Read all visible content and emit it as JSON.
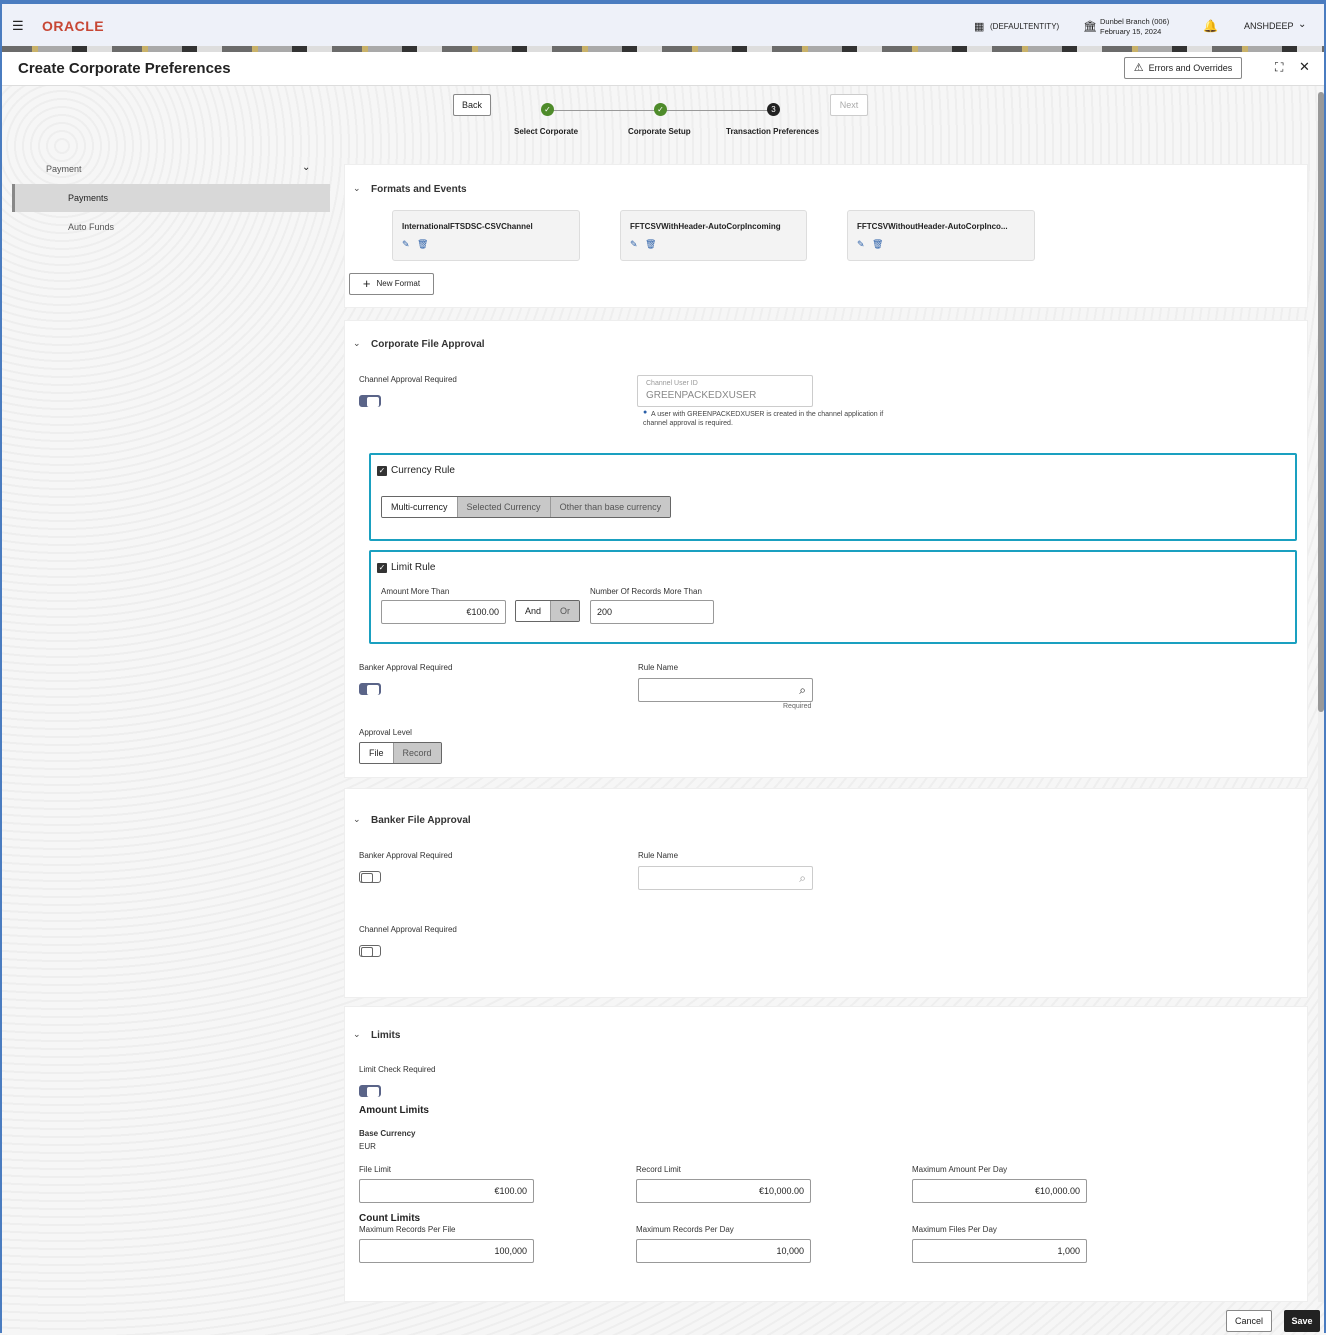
{
  "header": {
    "logo": "ORACLE",
    "entity": "(DEFAULTENTITY)",
    "branch": "Dunbel Branch (006)",
    "date": "February 15, 2024",
    "user": "ANSHDEEP"
  },
  "page": {
    "title": "Create Corporate Preferences",
    "errors_button": "Errors and Overrides"
  },
  "wizard": {
    "back": "Back",
    "next": "Next",
    "steps": [
      {
        "label": "Select Corporate",
        "state": "done"
      },
      {
        "label": "Corporate Setup",
        "state": "done"
      },
      {
        "label": "Transaction Preferences",
        "state": "current",
        "number": "3"
      }
    ]
  },
  "sidebar": {
    "group": "Payment",
    "items": [
      {
        "label": "Payments",
        "selected": true
      },
      {
        "label": "Auto Funds",
        "selected": false
      }
    ]
  },
  "formats": {
    "title": "Formats and Events",
    "cards": [
      "InternationalFTSDSC-CSVChannel",
      "FFTCSVWithHeader-AutoCorpIncoming",
      "FFTCSVWithoutHeader-AutoCorpInco..."
    ],
    "new_format": "New Format"
  },
  "corp_approval": {
    "title": "Corporate File Approval",
    "channel_approval_label": "Channel Approval Required",
    "channel_approval_on": true,
    "channel_user_label": "Channel User ID",
    "channel_user_value": "GREENPACKEDXUSER",
    "info": "A user with GREENPACKEDXUSER is created in the channel application if channel approval is required.",
    "currency_rule": {
      "label": "Currency Rule",
      "checked": true,
      "options": [
        "Multi-currency",
        "Selected Currency",
        "Other than base currency"
      ],
      "selected": "Multi-currency"
    },
    "limit_rule": {
      "label": "Limit Rule",
      "checked": true,
      "amount_label": "Amount More Than",
      "amount": "€100.00",
      "and": "And",
      "or": "Or",
      "selected": "And",
      "records_label": "Number Of Records More Than",
      "records": "200"
    },
    "banker_approval_label": "Banker Approval Required",
    "banker_approval_on": true,
    "rule_name_label": "Rule Name",
    "rule_name_value": "",
    "required": "Required",
    "approval_level_label": "Approval Level",
    "approval_levels": [
      "File",
      "Record"
    ],
    "approval_level_selected": "File"
  },
  "banker_approval": {
    "title": "Banker File Approval",
    "banker_label": "Banker Approval Required",
    "banker_on": false,
    "rule_name_label": "Rule Name",
    "channel_label": "Channel Approval Required",
    "channel_on": false
  },
  "limits": {
    "title": "Limits",
    "check_label": "Limit Check Required",
    "check_on": true,
    "amount_limits": "Amount Limits",
    "base_currency_label": "Base Currency",
    "base_currency": "EUR",
    "file_limit_label": "File Limit",
    "file_limit": "€100.00",
    "record_limit_label": "Record Limit",
    "record_limit": "€10,000.00",
    "max_amount_day_label": "Maximum Amount Per Day",
    "max_amount_day": "€10,000.00",
    "count_limits": "Count Limits",
    "max_rec_file_label": "Maximum Records Per File",
    "max_rec_file": "100,000",
    "max_rec_day_label": "Maximum Records Per Day",
    "max_rec_day": "10,000",
    "max_files_day_label": "Maximum Files Per Day",
    "max_files_day": "1,000"
  },
  "footer": {
    "cancel": "Cancel",
    "save": "Save"
  }
}
